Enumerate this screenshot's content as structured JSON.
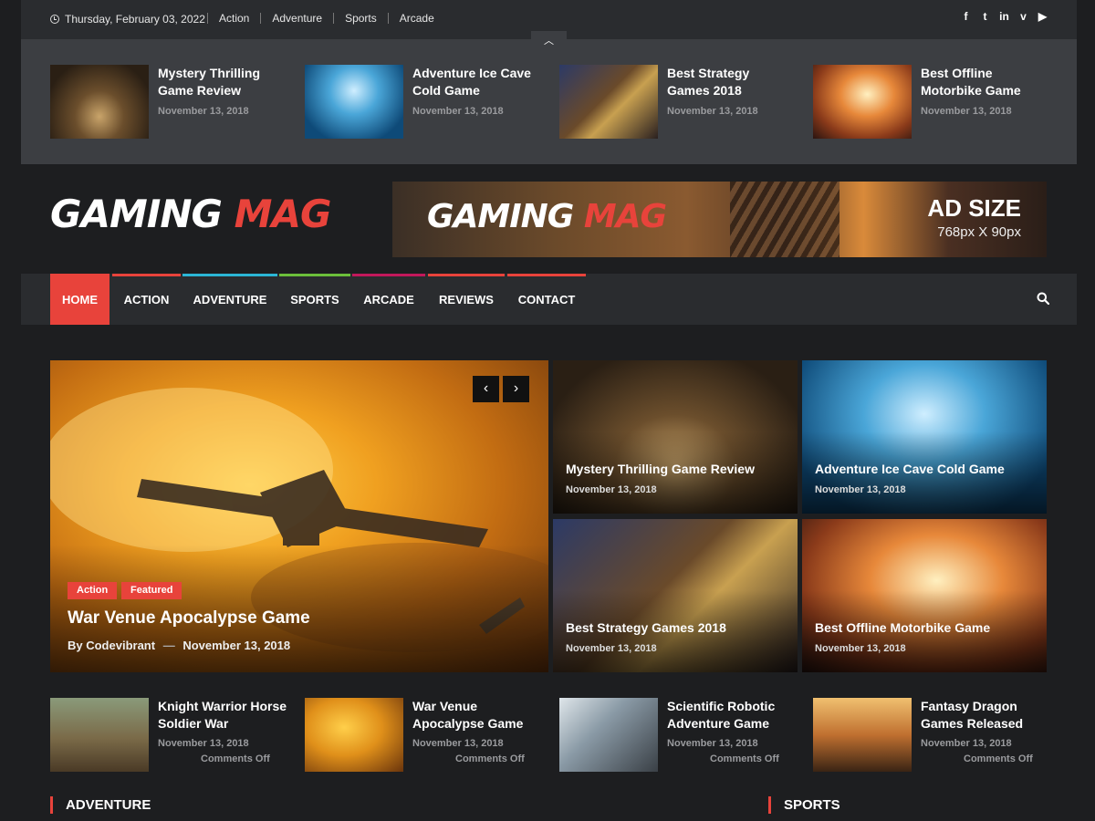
{
  "topbar": {
    "date": "Thursday, February 03, 2022",
    "links": [
      "Action",
      "Adventure",
      "Sports",
      "Arcade"
    ],
    "social": [
      "facebook-icon",
      "twitter-icon",
      "linkedin-icon",
      "vimeo-icon",
      "youtube-icon"
    ],
    "social_glyphs": [
      "f",
      "t",
      "in",
      "v",
      "▶"
    ]
  },
  "strip": {
    "items": [
      {
        "title": "Mystery Thrilling Game Review",
        "date": "November 13, 2018"
      },
      {
        "title": "Adventure Ice Cave Cold Game",
        "date": "November 13, 2018"
      },
      {
        "title": "Best Strategy Games 2018",
        "date": "November 13, 2018"
      },
      {
        "title": "Best Offline Motorbike Game",
        "date": "November 13, 2018"
      }
    ]
  },
  "header": {
    "logo_white": "GAMING",
    "logo_red": "MAG",
    "ad": {
      "logo_white": "GAMING",
      "logo_red": "MAG",
      "size": "AD SIZE",
      "dimensions": "768px X 90px"
    }
  },
  "nav": {
    "items": [
      "HOME",
      "ACTION",
      "ADVENTURE",
      "SPORTS",
      "ARCADE",
      "REVIEWS",
      "CONTACT"
    ],
    "accent_colors": [
      "#e8433b",
      "#e8433b",
      "#2bb6d6",
      "#6cbf3a",
      "#c2185b",
      "#e8433b",
      "#e8433b"
    ]
  },
  "hero": {
    "tags": [
      "Action",
      "Featured"
    ],
    "title": "War Venue Apocalypse Game",
    "author": "By Codevibrant",
    "separator": "—",
    "date": "November 13, 2018"
  },
  "grid": [
    {
      "title": "Mystery Thrilling Game Review",
      "date": "November 13, 2018"
    },
    {
      "title": "Adventure Ice Cave Cold Game",
      "date": "November 13, 2018"
    },
    {
      "title": "Best Strategy Games 2018",
      "date": "November 13, 2018"
    },
    {
      "title": "Best Offline Motorbike Game",
      "date": "November 13, 2018"
    }
  ],
  "row": [
    {
      "title": "Knight Warrior Horse Soldier War",
      "date": "November 13, 2018",
      "comments": "Comments Off"
    },
    {
      "title": "War Venue Apocalypse Game",
      "date": "November 13, 2018",
      "comments": "Comments Off"
    },
    {
      "title": "Scientific Robotic Adventure Game",
      "date": "November 13, 2018",
      "comments": "Comments Off"
    },
    {
      "title": "Fantasy Dragon Games Released",
      "date": "November 13, 2018",
      "comments": "Comments Off"
    }
  ],
  "sections": [
    "ADVENTURE",
    "SPORTS"
  ],
  "colors": {
    "accent": "#e8433b",
    "background": "#1d1e20",
    "panel": "#2a2c2f",
    "strip": "#3c3e42"
  }
}
